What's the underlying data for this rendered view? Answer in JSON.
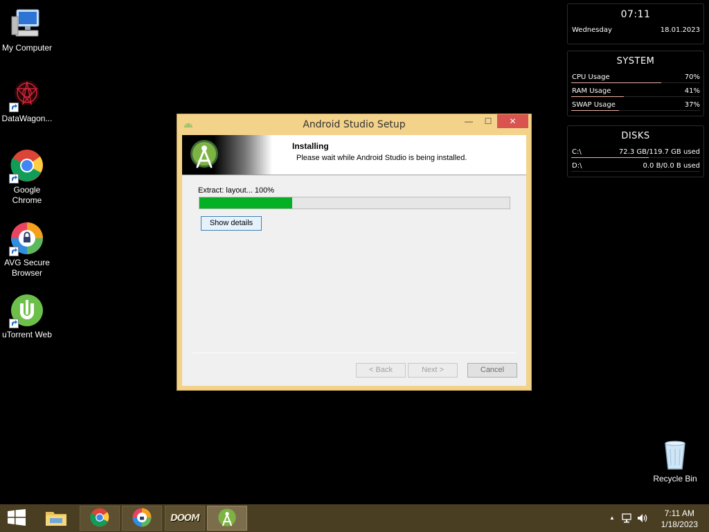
{
  "desktop": {
    "icons": [
      {
        "label": "My Computer",
        "icon": "computer-icon"
      },
      {
        "label": "DataWagon...",
        "icon": "datawagon-icon"
      },
      {
        "label": "Google Chrome",
        "icon": "chrome-icon"
      },
      {
        "label": "AVG Secure Browser",
        "icon": "avg-browser-icon"
      },
      {
        "label": "uTorrent Web",
        "icon": "utorrent-icon"
      },
      {
        "label": "Recycle Bin",
        "icon": "recycle-bin-icon"
      }
    ]
  },
  "widgets": {
    "clock": {
      "time": "07:11",
      "day": "Wednesday",
      "date": "18.01.2023"
    },
    "system": {
      "title": "SYSTEM",
      "rows": [
        {
          "label": "CPU Usage",
          "value": "70%",
          "level": 0.7
        },
        {
          "label": "RAM Usage",
          "value": "41%",
          "level": 0.41
        },
        {
          "label": "SWAP Usage",
          "value": "37%",
          "level": 0.37
        }
      ]
    },
    "disks": {
      "title": "DISKS",
      "rows": [
        {
          "label": "C:\\",
          "value": "72.3 GB/119.7 GB used",
          "level": 0.6
        },
        {
          "label": "D:\\",
          "value": "0.0 B/0.0 B used",
          "level": 0.0
        }
      ]
    },
    "accent_color": "#f0b1a6"
  },
  "installer": {
    "title": "Android Studio Setup",
    "heading": "Installing",
    "subheading": "Please wait while Android Studio is being installed.",
    "status": "Extract: layout... 100%",
    "progress": 0.3,
    "show_details_label": "Show details",
    "back_label": "< Back",
    "next_label": "Next >",
    "cancel_label": "Cancel",
    "minimize_glyph": "—",
    "maximize_glyph": "☐",
    "close_glyph": "✕",
    "progress_color": "#06b025"
  },
  "taskbar": {
    "items": [
      "file-explorer-icon",
      "chrome-icon",
      "avg-browser-icon",
      "doom-icon",
      "android-studio-icon"
    ],
    "doom_label": "DOOM",
    "clock_time": "7:11 AM",
    "clock_date": "1/18/2023",
    "tray_chevron": "▲",
    "color": "#4a3e22"
  }
}
